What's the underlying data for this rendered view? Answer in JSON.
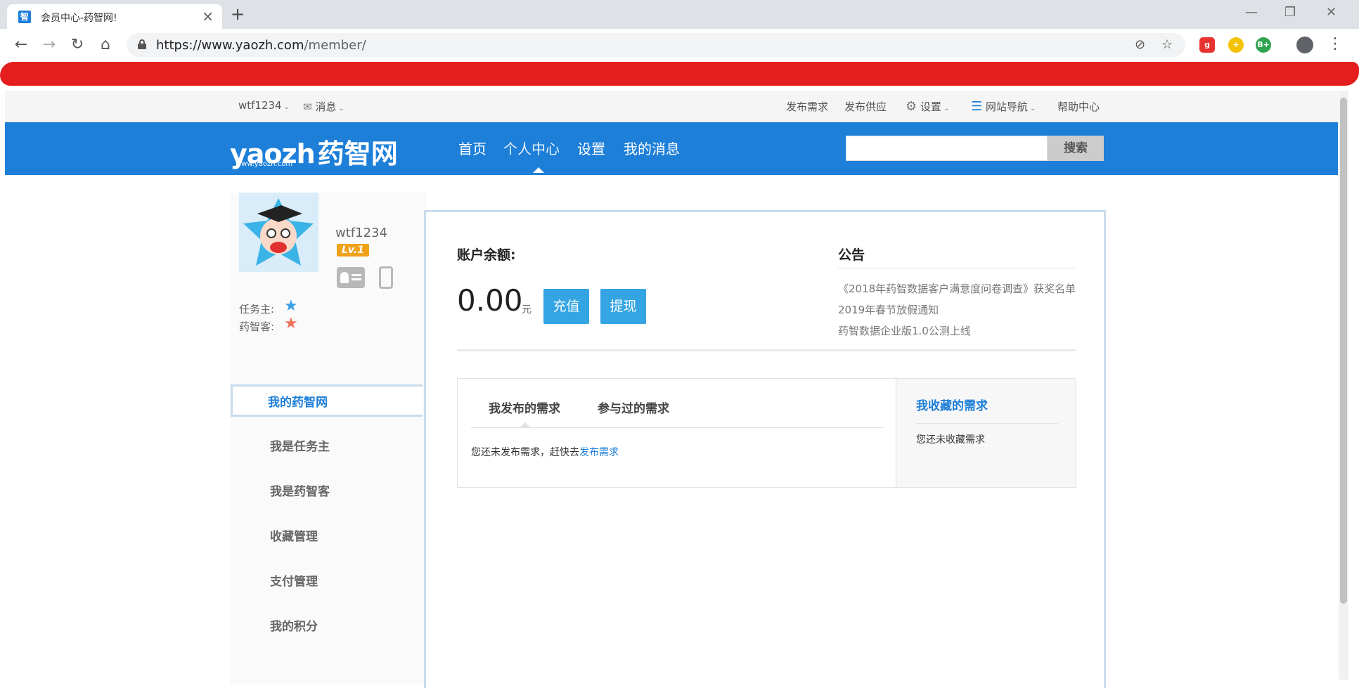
{
  "browser": {
    "tab_title": "会员中心-药智网!",
    "tab_favicon": "智",
    "url_host": "https://www.yaozh.com",
    "url_path": "/member/",
    "ext_icons": [
      "ext-red-icon",
      "ext-yellow-icon",
      "ext-green-icon"
    ],
    "ext_labels": [
      "g",
      "+",
      "B+"
    ]
  },
  "topbar": {
    "username": "wtf1234",
    "messages": "消息",
    "publish_demand": "发布需求",
    "publish_supply": "发布供应",
    "settings": "设置",
    "site_nav": "网站导航",
    "help_center": "帮助中心"
  },
  "header": {
    "logo_en": "yaozh",
    "logo_cn": "药智网",
    "logo_sub": "www.yaozh.com",
    "nav": [
      "首页",
      "个人中心",
      "设置",
      "我的消息"
    ],
    "active_nav": "个人中心",
    "search_placeholder": "",
    "search_button": "搜索",
    "brand_color": "#1e7fd9"
  },
  "profile": {
    "name": "wtf1234",
    "level": "Lv.1",
    "roles": [
      {
        "label": "任务主:",
        "star_color": "#3aa0e8"
      },
      {
        "label": "药智客:",
        "star_color": "#f0705a"
      }
    ]
  },
  "sidebar": {
    "items": [
      "我的药智网",
      "我是任务主",
      "我是药智客",
      "收藏管理",
      "支付管理",
      "我的积分"
    ],
    "active": "我的药智网"
  },
  "account": {
    "balance_label": "账户余额:",
    "balance_value": "0.00",
    "unit": "元",
    "recharge": "充值",
    "withdraw": "提现"
  },
  "notices": {
    "title": "公告",
    "items": [
      "《2018年药智数据客户满意度问卷调查》获奖名单",
      "2019年春节放假通知",
      "药智数据企业版1.0公测上线"
    ]
  },
  "requests": {
    "tabs": [
      "我发布的需求",
      "参与过的需求"
    ],
    "empty_text": "您还未发布需求，赶快去",
    "empty_link": "发布需求",
    "favorites_title": "我收藏的需求",
    "favorites_empty": "您还未收藏需求"
  }
}
